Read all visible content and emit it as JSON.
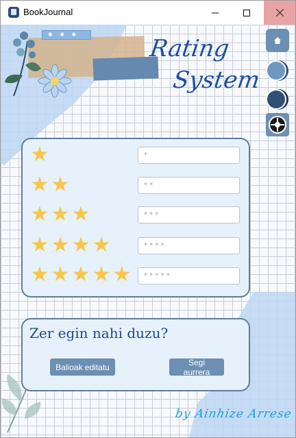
{
  "window": {
    "title": "BookJournal",
    "controls": {
      "minimize": "–",
      "maximize": "□",
      "close": "✕"
    }
  },
  "heading": {
    "line1": "Rating",
    "line2": "System"
  },
  "tape_text": "✱ ✱ ✱",
  "side_buttons": [
    {
      "icon": "home-icon"
    },
    {
      "icon": "color-light-blue",
      "color": "#6f97c2"
    },
    {
      "icon": "color-dark-blue",
      "color": "#2f4f73"
    },
    {
      "icon": "theme-toggle-icon"
    }
  ],
  "ratings": [
    {
      "stars": 1,
      "value": "*"
    },
    {
      "stars": 2,
      "value": "* *"
    },
    {
      "stars": 3,
      "value": "* * *"
    },
    {
      "stars": 4,
      "value": "* * * *"
    },
    {
      "stars": 5,
      "value": "* * * * *"
    }
  ],
  "question_card": {
    "question": "Zer egin nahi duzu?",
    "edit_button": "Balioak editatu",
    "next_button": "Segi aurrera"
  },
  "signature": "by Ainhize Arrese",
  "colors": {
    "accent": "#6c8fb3",
    "star": "#f7c64a",
    "heading": "#1e4fa0",
    "card_bg": "#e6f1fb"
  }
}
